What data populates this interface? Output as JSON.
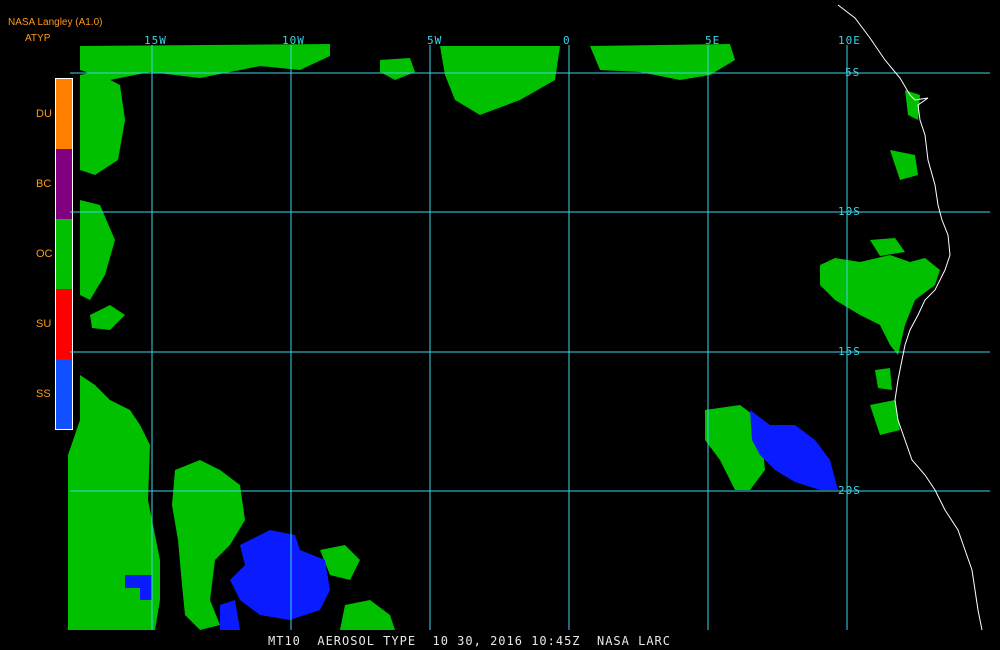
{
  "header": {
    "org": "NASA Langley (A1.0)",
    "product": "ATYP"
  },
  "legend": [
    {
      "code": "DU",
      "color": "#ff8000"
    },
    {
      "code": "BC",
      "color": "#800080"
    },
    {
      "code": "OC",
      "color": "#00c000"
    },
    {
      "code": "SU",
      "color": "#ff0000"
    },
    {
      "code": "SS",
      "color": "#1050ff"
    }
  ],
  "grid": {
    "lon_labels": [
      "15W",
      "10W",
      "5W",
      "0",
      "5E",
      "10E"
    ],
    "lat_labels": [
      "5S",
      "10S",
      "15S",
      "20S"
    ]
  },
  "colors": {
    "grid": "#3ad6e6",
    "coast": "#ffffff",
    "background": "#000000"
  },
  "footer": {
    "caption": "MT10  AEROSOL TYPE  10 30, 2016 10:45Z  NASA LARC"
  }
}
